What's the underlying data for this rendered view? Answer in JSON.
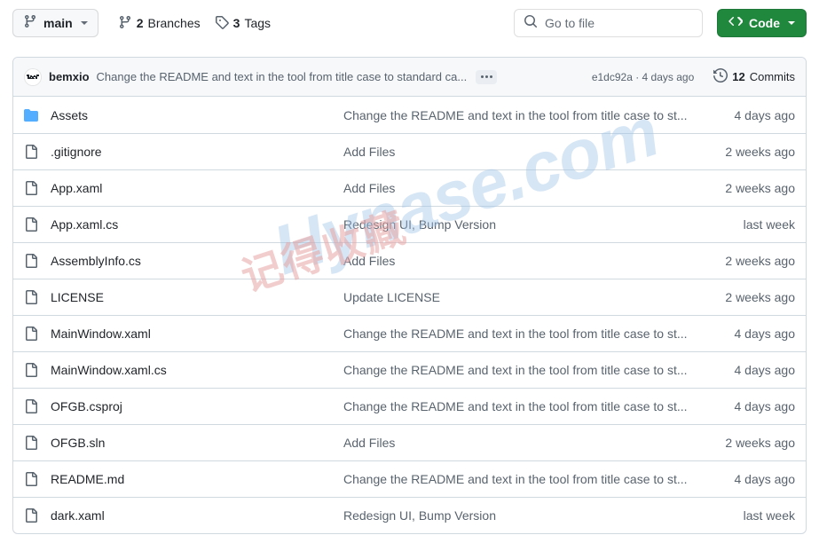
{
  "toolbar": {
    "branch": {
      "name": "main",
      "icon": "git-branch-icon",
      "caret": "chevron-down-icon"
    },
    "branches": {
      "count": "2",
      "label": "Branches",
      "icon": "git-branch-icon"
    },
    "tags": {
      "count": "3",
      "label": "Tags",
      "icon": "tag-icon"
    },
    "search": {
      "placeholder": "Go to file",
      "icon": "search-icon"
    },
    "code_button": {
      "label": "Code",
      "icon": "code-brackets-icon",
      "caret": "chevron-down-icon",
      "color": "#1f883d"
    }
  },
  "commit_bar": {
    "author": "bemxio",
    "message": "Change the README and text in the tool from title case to standard ca...",
    "expand_icon": "ellipsis-icon",
    "sha_and_time": "e1dc92a · 4 days ago",
    "history_icon": "history-clock-icon",
    "commits_count": "12",
    "commits_label": "Commits"
  },
  "files": [
    {
      "name": "Assets",
      "type": "folder",
      "icon": "folder-icon",
      "message": "Change the README and text in the tool from title case to st...",
      "time": "4 days ago"
    },
    {
      "name": ".gitignore",
      "type": "file",
      "icon": "file-icon",
      "message": "Add Files",
      "time": "2 weeks ago"
    },
    {
      "name": "App.xaml",
      "type": "file",
      "icon": "file-icon",
      "message": "Add Files",
      "time": "2 weeks ago"
    },
    {
      "name": "App.xaml.cs",
      "type": "file",
      "icon": "file-icon",
      "message": "Redesign UI, Bump Version",
      "time": "last week"
    },
    {
      "name": "AssemblyInfo.cs",
      "type": "file",
      "icon": "file-icon",
      "message": "Add Files",
      "time": "2 weeks ago"
    },
    {
      "name": "LICENSE",
      "type": "file",
      "icon": "file-icon",
      "message": "Update LICENSE",
      "time": "2 weeks ago"
    },
    {
      "name": "MainWindow.xaml",
      "type": "file",
      "icon": "file-icon",
      "message": "Change the README and text in the tool from title case to st...",
      "time": "4 days ago"
    },
    {
      "name": "MainWindow.xaml.cs",
      "type": "file",
      "icon": "file-icon",
      "message": "Change the README and text in the tool from title case to st...",
      "time": "4 days ago"
    },
    {
      "name": "OFGB.csproj",
      "type": "file",
      "icon": "file-icon",
      "message": "Change the README and text in the tool from title case to st...",
      "time": "4 days ago"
    },
    {
      "name": "OFGB.sln",
      "type": "file",
      "icon": "file-icon",
      "message": "Add Files",
      "time": "2 weeks ago"
    },
    {
      "name": "README.md",
      "type": "file",
      "icon": "file-icon",
      "message": "Change the README and text in the tool from title case to st...",
      "time": "4 days ago"
    },
    {
      "name": "dark.xaml",
      "type": "file",
      "icon": "file-icon",
      "message": "Redesign UI, Bump Version",
      "time": "last week"
    }
  ],
  "watermark": {
    "latin": "Hynase.com",
    "cjk": "记得收藏"
  }
}
